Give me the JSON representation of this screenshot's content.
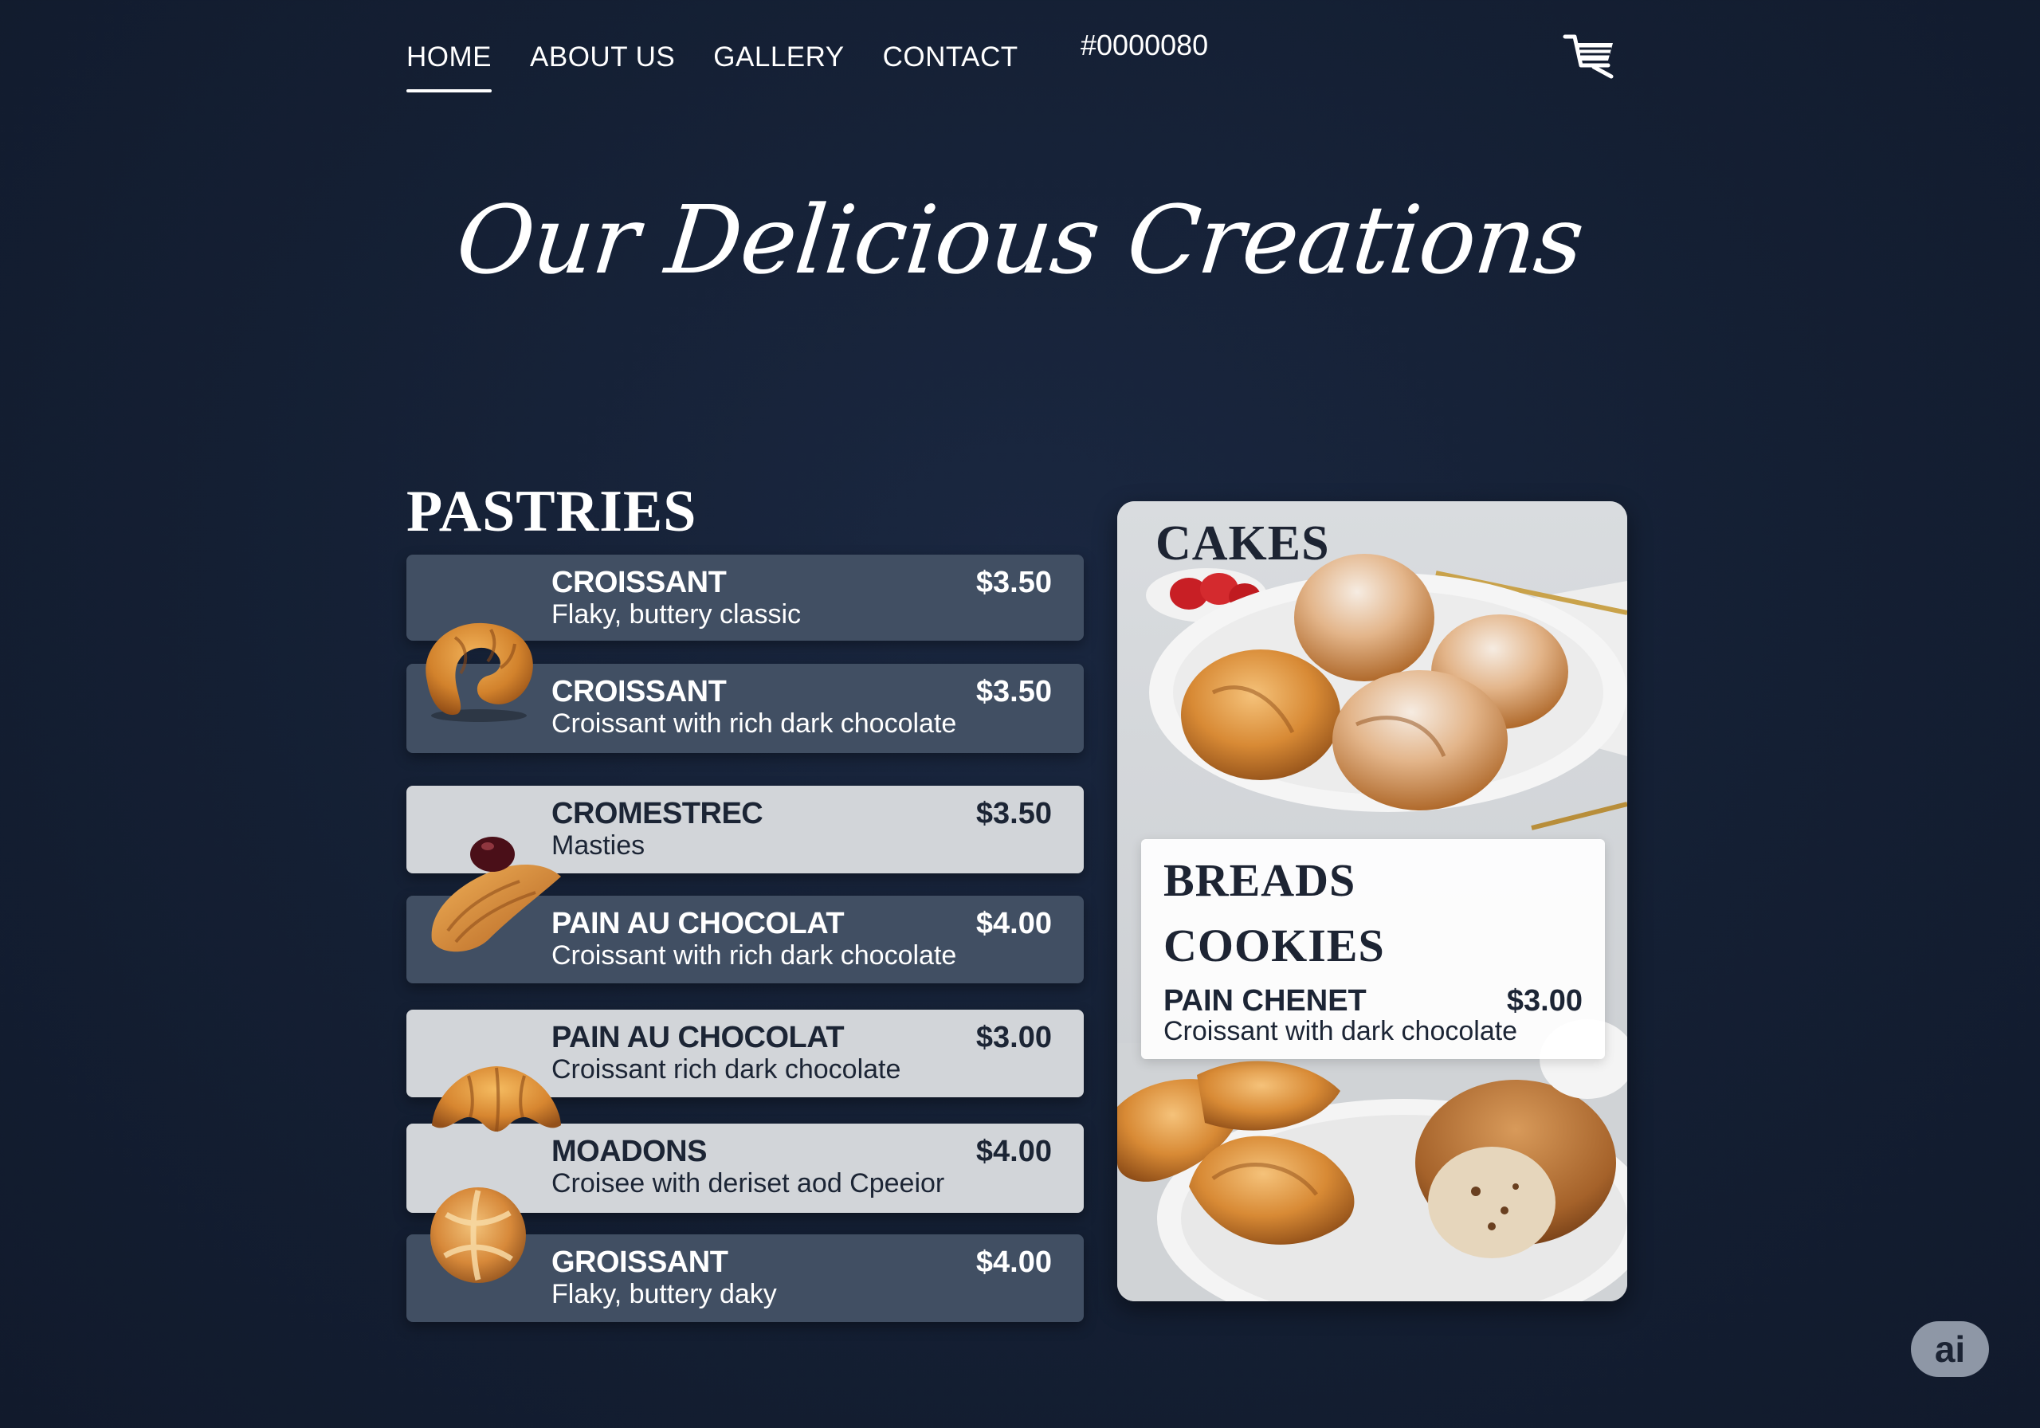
{
  "nav": {
    "items": [
      {
        "label": "HOME",
        "active": true
      },
      {
        "label": "ABOUT US",
        "active": false
      },
      {
        "label": "GALLERY",
        "active": false
      },
      {
        "label": "CONTACT",
        "active": false
      }
    ],
    "hex_code": "#0000080",
    "cart_icon": "shopping-cart-icon"
  },
  "hero": {
    "title": "Our Delicious Creations"
  },
  "pastries": {
    "title": "PASTRIES",
    "items": [
      {
        "name": "CROISSANT",
        "desc": "Flaky, buttery classic",
        "price": "$3.50"
      },
      {
        "name": "CROISSANT",
        "desc": "Croissant with rich dark chocolate",
        "price": "$3.50"
      },
      {
        "name": "CROMESTREC",
        "desc": "Masties",
        "price": "$3.50"
      },
      {
        "name": "PAIN AU CHOCOLAT",
        "desc": "Croissant with rich dark chocolate",
        "price": "$4.00"
      },
      {
        "name": "PAIN AU CHOCOLAT",
        "desc": "Croissant rich dark chocolate",
        "price": "$3.00"
      },
      {
        "name": "MOADONS",
        "desc": "Croisee with deriset aod Cpeeior",
        "price": "$4.00"
      },
      {
        "name": "GROISSANT",
        "desc": "Flaky, buttery daky",
        "price": "$4.00"
      }
    ]
  },
  "card": {
    "cakes_title": "CAKES",
    "breads_title": "BREADS",
    "cookies_title": "COOKIES",
    "featured": {
      "name": "PAIN CHENET",
      "desc": "Croissant with dark chocolate",
      "price": "$3.00"
    }
  },
  "badge": {
    "label": "ai"
  },
  "colors": {
    "background": "#131d30",
    "row_dark": "#414f63",
    "row_light": "#d2d5d9",
    "text_dark": "#1c2535"
  }
}
